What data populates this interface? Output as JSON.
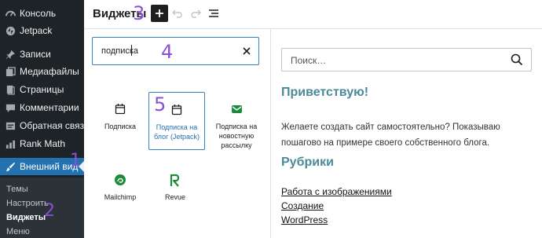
{
  "sidebar": {
    "items": [
      {
        "label": "Консоль",
        "icon": "dashboard-icon"
      },
      {
        "label": "Jetpack",
        "icon": "jetpack-icon"
      },
      {
        "label": "Записи",
        "icon": "pin-icon"
      },
      {
        "label": "Медиафайлы",
        "icon": "media-icon"
      },
      {
        "label": "Страницы",
        "icon": "pages-icon"
      },
      {
        "label": "Комментарии",
        "icon": "comments-icon"
      },
      {
        "label": "Обратная связь",
        "icon": "feedback-icon"
      },
      {
        "label": "Rank Math",
        "icon": "rank-math-icon"
      },
      {
        "label": "Внешний вид",
        "icon": "brush-icon",
        "active": true
      }
    ],
    "submenu": [
      {
        "label": "Темы"
      },
      {
        "label": "Настроить"
      },
      {
        "label": "Виджеты",
        "current": true
      },
      {
        "label": "Меню"
      }
    ]
  },
  "annotations": {
    "m1": "1",
    "m2": "2",
    "m3": "3",
    "m4": "4",
    "m5": "5"
  },
  "header": {
    "title": "Виджеты"
  },
  "inserter": {
    "search_value": "подписка",
    "blocks": [
      {
        "label": "Подписка",
        "icon": "calendar-icon"
      },
      {
        "label": "Подписка на блог (Jetpack)",
        "icon": "calendar-icon",
        "selected": true
      },
      {
        "label": "Подписка на новостную рассылку",
        "icon": "newsletter-icon"
      },
      {
        "label": "Mailchimp",
        "icon": "mailchimp-icon"
      },
      {
        "label": "Revue",
        "icon": "revue-icon"
      }
    ]
  },
  "preview": {
    "search_placeholder": "Поиск…",
    "greeting_heading": "Приветствую!",
    "greeting_text": "Желаете создать сайт самостоятельно? Показываю пошагово на примере своего  собственного блога.",
    "categories_heading": "Рубрики",
    "categories": [
      "Работа с изображениями",
      "Создание",
      "WordPress"
    ]
  },
  "colors": {
    "sidebar_bg": "#1d2327",
    "accent": "#2271b1",
    "annotation": "#8a4fd6",
    "heading": "#4a8a9a"
  }
}
